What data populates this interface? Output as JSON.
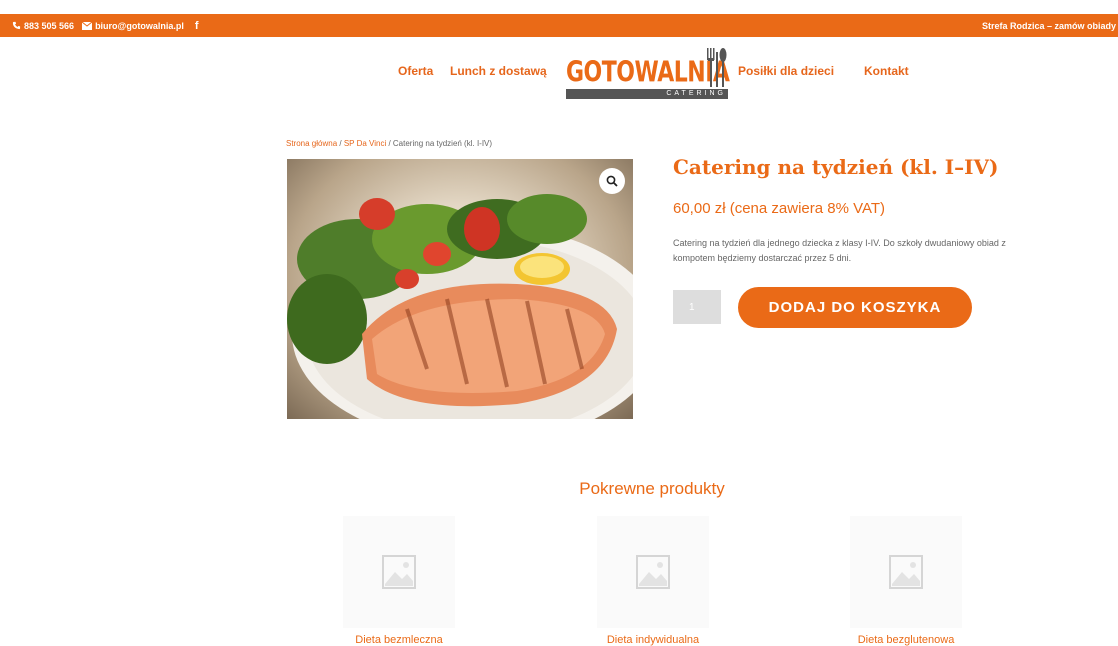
{
  "topbar": {
    "phone": "883 505 566",
    "email": "biuro@gotowalnia.pl",
    "facebook": "f",
    "right_link": "Strefa Rodzica – zamów obiady"
  },
  "nav": {
    "items": [
      "Oferta",
      "Lunch z dostawą",
      "Posiłki dla dzieci",
      "Kontakt"
    ]
  },
  "logo": {
    "name": "GOTOWALNIA",
    "tagline": "CATERING"
  },
  "breadcrumb": {
    "home": "Strona główna",
    "sep1": " / ",
    "category": "SP Da Vinci",
    "sep2": " / ",
    "current": "Catering na tydzień (kl. I-IV)"
  },
  "product": {
    "title": "Catering na tydzień (kl. I–IV)",
    "price": "60,00 zł (cena zawiera 8% VAT)",
    "description": "Catering na tydzień dla jednego dziecka z klasy I-IV. Do szkoły dwudaniowy obiad z kompotem będziemy dostarczać przez 5 dni.",
    "quantity": "1",
    "add_to_cart": "DODAJ DO KOSZYKA",
    "image_icon": "zoom-icon"
  },
  "related": {
    "title": "Pokrewne produkty",
    "items": [
      {
        "name": "Dieta bezmleczna"
      },
      {
        "name": "Dieta indywidualna"
      },
      {
        "name": "Dieta bezglutenowa"
      }
    ]
  },
  "colors": {
    "accent": "#ea6a17",
    "logo_bar": "#555555"
  }
}
